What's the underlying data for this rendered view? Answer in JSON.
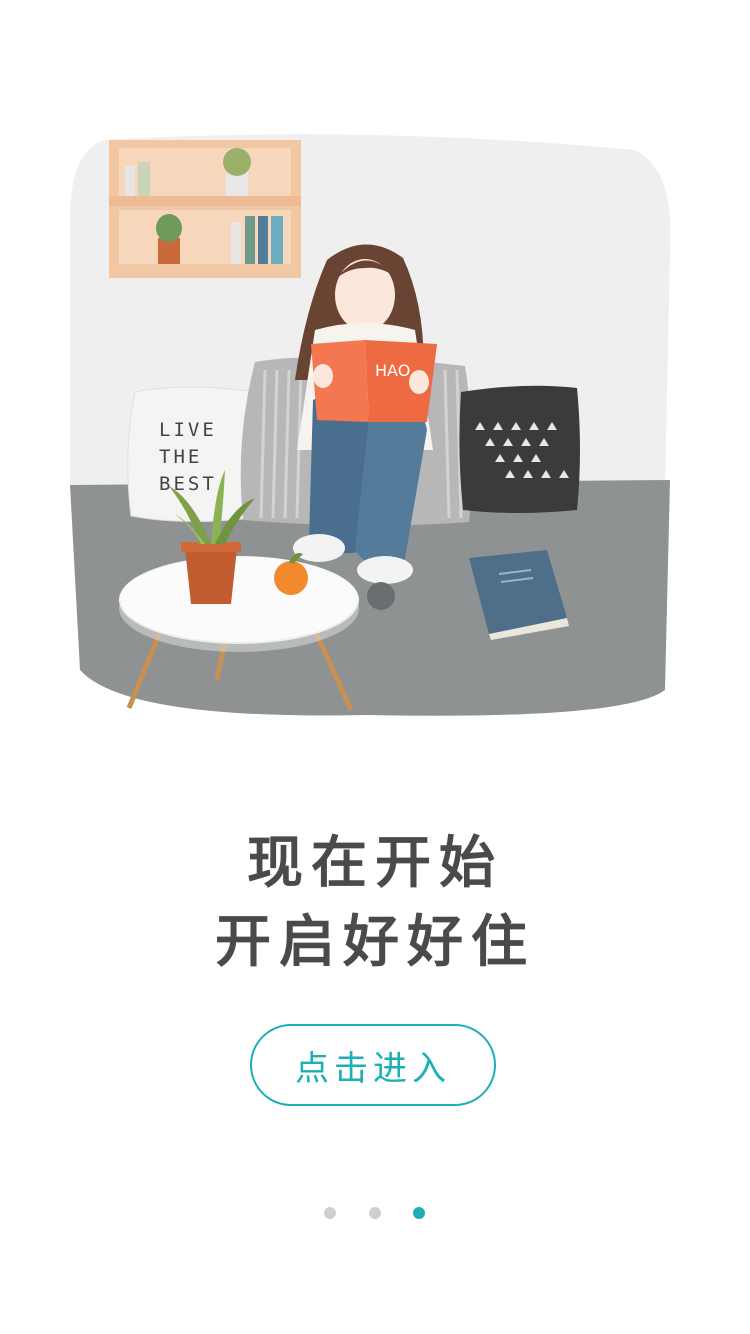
{
  "headline": {
    "line1": "现在开始",
    "line2": "开启好好住"
  },
  "enter_button": {
    "label": "点击进入"
  },
  "illustration": {
    "pillow_text": [
      "LIVE",
      "THE",
      "BEST"
    ],
    "book_text": "HAO"
  },
  "pagination": {
    "total": 3,
    "active_index": 2
  },
  "colors": {
    "accent": "#1cb0b4",
    "headline": "#4a4a4a",
    "dot_inactive": "#cfcfcf"
  }
}
